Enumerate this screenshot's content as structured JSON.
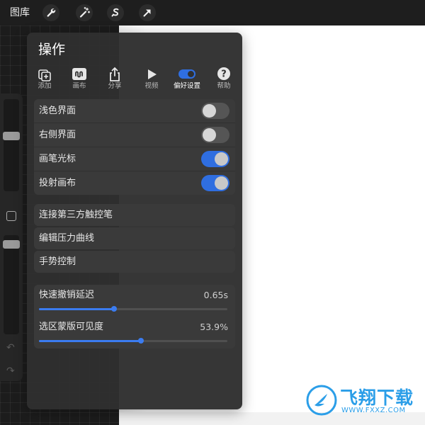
{
  "topbar": {
    "gallery_label": "图库",
    "tools": [
      {
        "name": "wrench-icon"
      },
      {
        "name": "magic-wand-icon"
      },
      {
        "name": "selection-s-icon"
      },
      {
        "name": "arrow-transform-icon"
      }
    ]
  },
  "panel": {
    "title": "操作",
    "tabs": [
      {
        "label": "添加",
        "icon": "add-layer-icon",
        "active": false
      },
      {
        "label": "画布",
        "icon": "canvas-wave-icon",
        "active": false
      },
      {
        "label": "分享",
        "icon": "share-icon",
        "active": false
      },
      {
        "label": "视频",
        "icon": "play-icon",
        "active": false
      },
      {
        "label": "偏好设置",
        "icon": "toggle-icon",
        "active": true
      },
      {
        "label": "帮助",
        "icon": "help-icon",
        "active": false
      }
    ],
    "toggles": [
      {
        "label": "浅色界面",
        "on": false
      },
      {
        "label": "右侧界面",
        "on": false
      },
      {
        "label": "画笔光标",
        "on": true
      },
      {
        "label": "投射画布",
        "on": true
      }
    ],
    "links": [
      {
        "label": "连接第三方触控笔"
      },
      {
        "label": "编辑压力曲线"
      },
      {
        "label": "手势控制"
      }
    ],
    "sliders": [
      {
        "label": "快速撤销延迟",
        "value": "0.65s",
        "fraction": 0.4
      },
      {
        "label": "选区蒙版可见度",
        "value": "53.9%",
        "fraction": 0.54
      }
    ]
  },
  "watermark": {
    "name": "飞翔下载",
    "url": "WWW.FXXZ.COM"
  },
  "colors": {
    "accent": "#2f6ee0",
    "panel_bg": "#303030",
    "row_bg": "#3a3a3a",
    "watermark": "#2b9ee8"
  }
}
